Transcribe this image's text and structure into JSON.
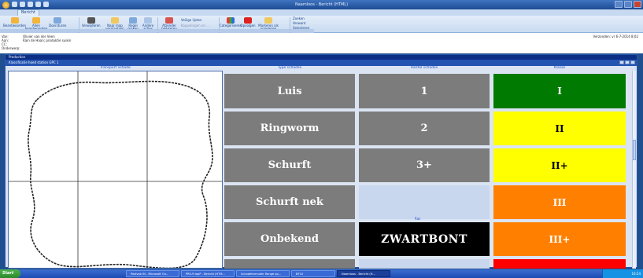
{
  "window": {
    "title": "Naamloos - Bericht (HTML)"
  },
  "ribbon": {
    "tab": "Bericht",
    "buttons": {
      "beantwoorden": "Beantwoorden",
      "allen_beantwoorden": "Allen beantwoorden",
      "doorsturen": "Doorsturen",
      "verwijderen": "Verwijderen",
      "naar_map_verplaatsen": "Naar map verplaatsen",
      "regel_maken": "Regel maken",
      "andere_acties": "Andere acties",
      "afzender_blokkeren": "Afzender blokkeren",
      "veilige_lijsten": "Veilige lijsten",
      "koppelingen": "Koppelingen en ...",
      "categoriseren": "Categoriseren",
      "opvolgen": "Opvolgen",
      "markeren_als_ongelezen": "Markeren als ongelezen",
      "zoeken": "Zoeken",
      "verwant": "Verwant",
      "selecteren": "Selecteren"
    }
  },
  "mail": {
    "van_label": "Van:",
    "van": "Olivier van der Veen",
    "aan_label": "Aan:",
    "aan": "Rain de Haan; produktie suikin",
    "cc_label": "CC:",
    "onderwerp_label": "Onderwerp:",
    "verzonden_label": "Verzonden:",
    "verzonden": "vr 6-7-2014 8:02"
  },
  "app": {
    "title": "Production",
    "subtitle": "Klassificatie hoed station GPC 1",
    "controls": [
      "minimize",
      "restore",
      "close"
    ]
  },
  "table": {
    "headers": {
      "transport": "Transport schade",
      "type": "Type schades",
      "aantal": "Aantal schades",
      "klasse": "Klasse"
    },
    "types": [
      "Luis",
      "Ringworm",
      "Schurft",
      "Schurft nek",
      "Onbekend",
      ""
    ],
    "aantal": [
      "1",
      "2",
      "3+",
      "",
      ""
    ],
    "ras_label": "Ras",
    "ras_value": "ZWARTBONT",
    "klasse": [
      {
        "label": "I",
        "color": "#007a00",
        "text_color": "#ffffff"
      },
      {
        "label": "II",
        "color": "#ffff00",
        "text_color": "#000000"
      },
      {
        "label": "II+",
        "color": "#ffff00",
        "text_color": "#000000"
      },
      {
        "label": "III",
        "color": "#ff8000",
        "text_color": "#ffffff"
      },
      {
        "label": "III+",
        "color": "#ff8000",
        "text_color": "#ffffff"
      },
      {
        "label": "",
        "color": "#ff0000",
        "text_color": "#ffffff"
      }
    ]
  },
  "taskbar": {
    "start": "Start",
    "items": [
      "Postvak IN - Microsoft Ou...",
      "PRV-9 tapP - Bericht (HTM...",
      "Schadeformulier Range op...",
      "BF10",
      "Naamloos - Bericht (H..."
    ],
    "active_index": 4,
    "clock": "10:24"
  }
}
